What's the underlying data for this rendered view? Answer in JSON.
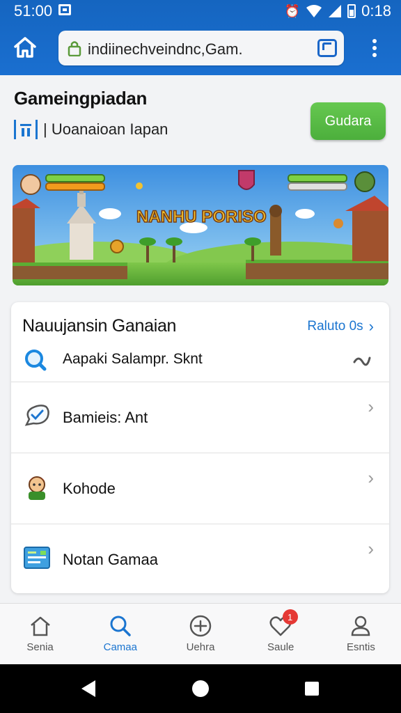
{
  "status_bar": {
    "time": "51:00",
    "clock_right": "0:18",
    "icons": [
      "notification-icon",
      "alarm-icon",
      "wifi-icon",
      "signal-icon",
      "battery-icon"
    ]
  },
  "browser": {
    "url": "indiinechveindnc,Gam.",
    "home_icon": "home-icon",
    "tabs_icon": "tabs-icon",
    "menu_icon": "more-vert-icon"
  },
  "header": {
    "title": "Gameingpiadan",
    "subtitle": "| Uoanaioan Iapan",
    "action_label": "Gudara",
    "action_color": "#5bbd47"
  },
  "banner": {
    "title": "NANHU PORISO",
    "accent": "#f2c230"
  },
  "list": {
    "title": "Nauujansin Ganaian",
    "link_label": "Raluto 0s",
    "search_text": "Aapaki Salampr. Sknt",
    "items": [
      {
        "label": "Bamieis: Ant",
        "icon": "speech-bubble-check-icon"
      },
      {
        "label": "Kohode",
        "icon": "character-avatar-icon"
      },
      {
        "label": "Notan Gamaa",
        "icon": "dashboard-card-icon"
      }
    ]
  },
  "bottom_nav": {
    "items": [
      {
        "label": "Senia",
        "icon": "home-icon",
        "active": false
      },
      {
        "label": "Camaa",
        "icon": "search-icon",
        "active": true
      },
      {
        "label": "Uehra",
        "icon": "compass-icon",
        "active": false
      },
      {
        "label": "Saule",
        "icon": "heart-icon",
        "active": false,
        "badge": "1"
      },
      {
        "label": "Esntis",
        "icon": "profile-icon",
        "active": false
      }
    ]
  },
  "colors": {
    "primary": "#1565c0",
    "accent_blue": "#1b75d0",
    "green": "#5bbd47",
    "badge_red": "#e53935"
  }
}
